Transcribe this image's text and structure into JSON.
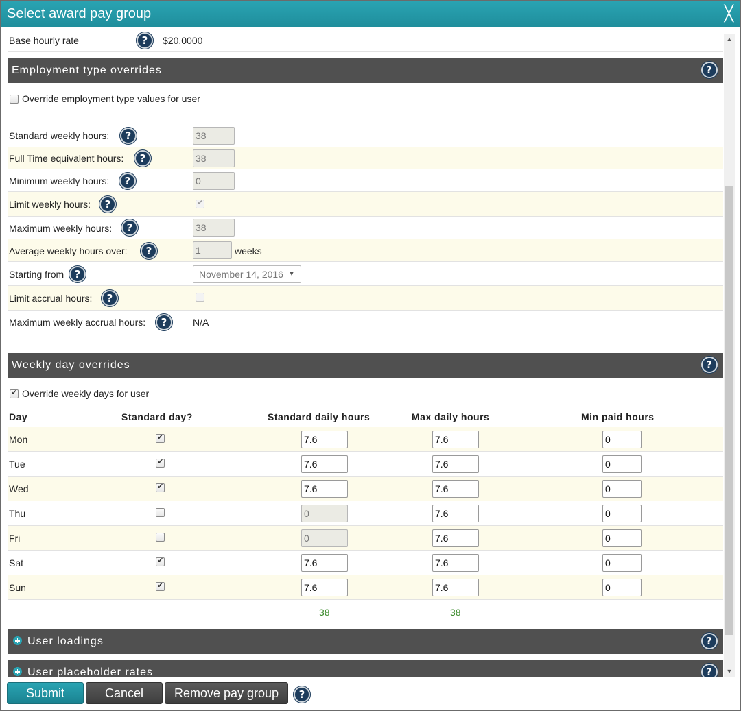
{
  "title": "Select award pay group",
  "base_rate": {
    "label": "Base hourly rate",
    "value": "$20.0000"
  },
  "employment": {
    "section_title": "Employment type overrides",
    "override_label": "Override employment type values for user",
    "override_checked": false,
    "fields": {
      "standard_weekly": {
        "label": "Standard weekly hours:",
        "value": "38"
      },
      "fte": {
        "label": "Full Time equivalent hours:",
        "value": "38"
      },
      "min_weekly": {
        "label": "Minimum weekly hours:",
        "value": "0"
      },
      "limit_weekly": {
        "label": "Limit weekly hours:",
        "checked": true
      },
      "max_weekly": {
        "label": "Maximum weekly hours:",
        "value": "38"
      },
      "average_over": {
        "label": "Average weekly hours over:",
        "value": "1",
        "unit": "weeks"
      },
      "starting_from": {
        "label": "Starting from",
        "value": "November 14, 2016"
      },
      "limit_accrual": {
        "label": "Limit accrual hours:",
        "checked": false
      },
      "max_accrual": {
        "label": "Maximum weekly accrual hours:",
        "value": "N/A"
      }
    }
  },
  "weekly": {
    "section_title": "Weekly day overrides",
    "override_label": "Override weekly days for user",
    "override_checked": true,
    "headers": {
      "day": "Day",
      "standard_day": "Standard day?",
      "std_daily": "Standard daily hours",
      "max_daily": "Max daily hours",
      "min_paid": "Min paid hours"
    },
    "rows": [
      {
        "day": "Mon",
        "standard": true,
        "std": "7.6",
        "max": "7.6",
        "min": "0"
      },
      {
        "day": "Tue",
        "standard": true,
        "std": "7.6",
        "max": "7.6",
        "min": "0"
      },
      {
        "day": "Wed",
        "standard": true,
        "std": "7.6",
        "max": "7.6",
        "min": "0"
      },
      {
        "day": "Thu",
        "standard": false,
        "std": "0",
        "max": "7.6",
        "min": "0"
      },
      {
        "day": "Fri",
        "standard": false,
        "std": "0",
        "max": "7.6",
        "min": "0"
      },
      {
        "day": "Sat",
        "standard": true,
        "std": "7.6",
        "max": "7.6",
        "min": "0"
      },
      {
        "day": "Sun",
        "standard": true,
        "std": "7.6",
        "max": "7.6",
        "min": "0"
      }
    ],
    "totals": {
      "std": "38",
      "max": "38"
    }
  },
  "sections": {
    "user_loadings": "User loadings",
    "user_placeholder_rates": "User placeholder rates"
  },
  "footer": {
    "submit": "Submit",
    "cancel": "Cancel",
    "remove": "Remove pay group"
  },
  "icons": {
    "help": "help-icon",
    "close": "close-icon",
    "expand": "expand-icon"
  }
}
